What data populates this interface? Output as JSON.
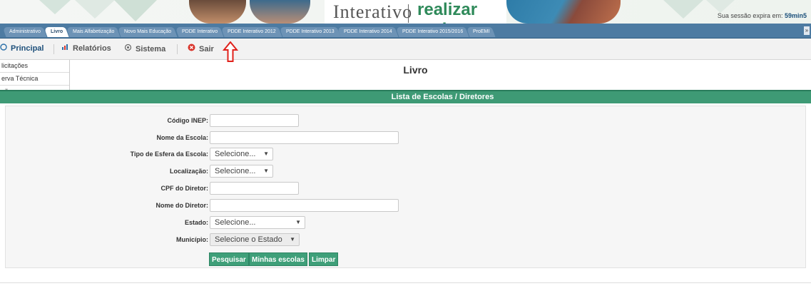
{
  "banner": {
    "logo_text_1": "Interativo",
    "logo_text_2": "realizar mais",
    "session_label": "Sua sessão expira em: ",
    "session_time": "59min5"
  },
  "tabs": [
    {
      "label": "Administrativo",
      "active": false
    },
    {
      "label": "Livro",
      "active": true
    },
    {
      "label": "Mais Alfabetização",
      "active": false
    },
    {
      "label": "Novo Mais Educação",
      "active": false
    },
    {
      "label": "PDDE Interativo",
      "active": false
    },
    {
      "label": "PDDE Interativo 2012",
      "active": false
    },
    {
      "label": "PDDE Interativo 2013",
      "active": false
    },
    {
      "label": "PDDE Interativo 2014",
      "active": false
    },
    {
      "label": "PDDE Interativo 2015/2016",
      "active": false
    },
    {
      "label": "ProEMI",
      "active": false
    }
  ],
  "tab_scroll": "»",
  "menu": {
    "principal": {
      "label": "Principal",
      "icon": "globe-icon"
    },
    "relatorios": {
      "label": "Relatórios",
      "icon": "chart-icon"
    },
    "sistema": {
      "label": "Sistema",
      "icon": "gear-icon"
    },
    "sair": {
      "label": "Sair",
      "icon": "close-circle-icon"
    }
  },
  "sidebar": {
    "items": [
      {
        "label": "licitações"
      },
      {
        "label": "erva Técnica"
      },
      {
        "label": "são"
      }
    ]
  },
  "page": {
    "title": "Livro",
    "section_title": "Lista de Escolas / Diretores"
  },
  "form": {
    "codigo_inep": {
      "label": "Código INEP:",
      "value": ""
    },
    "nome_escola": {
      "label": "Nome da Escola:",
      "value": ""
    },
    "tipo_esfera": {
      "label": "Tipo de Esfera da Escola:",
      "selected": "Selecione..."
    },
    "localizacao": {
      "label": "Localização:",
      "selected": "Selecione..."
    },
    "cpf_diretor": {
      "label": "CPF do Diretor:",
      "value": ""
    },
    "nome_diretor": {
      "label": "Nome do Diretor:",
      "value": ""
    },
    "estado": {
      "label": "Estado:",
      "selected": "Selecione..."
    },
    "municipio": {
      "label": "Município:",
      "selected": "Selecione o Estado"
    }
  },
  "buttons": {
    "pesquisar": "Pesquisar",
    "minhas_escolas": "Minhas escolas",
    "limpar": "Limpar"
  },
  "colors": {
    "tabbar": "#4d7ba2",
    "accent_green": "#3e9a75",
    "arrow_red": "#e0211b"
  }
}
